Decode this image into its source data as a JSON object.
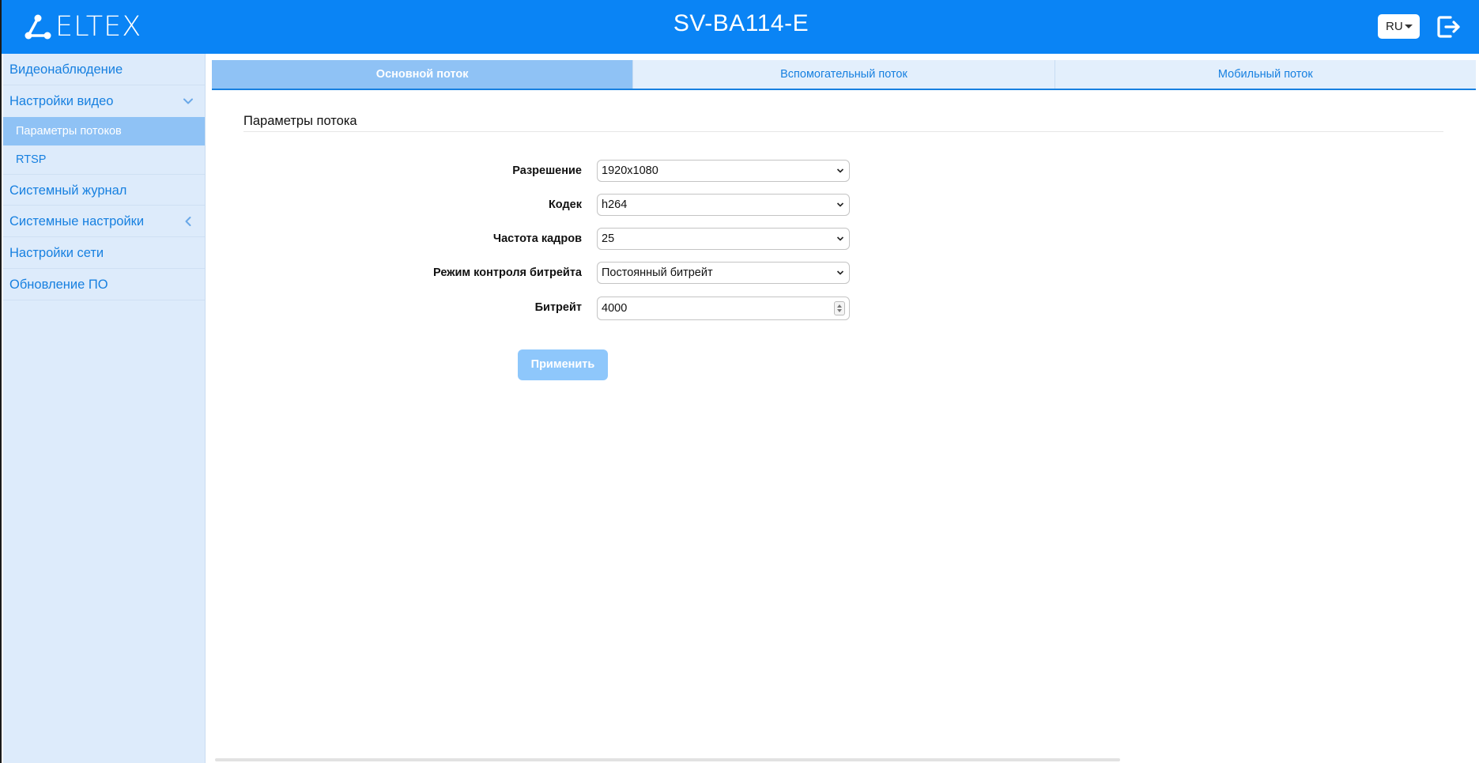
{
  "header": {
    "logo_text": "ELTEX",
    "device_title": "SV-BA114-E",
    "language": "RU"
  },
  "sidebar": {
    "items": [
      {
        "label": "Видеонаблюдение"
      },
      {
        "label": "Настройки видео",
        "expanded": true,
        "subitems": [
          {
            "label": "Параметры потоков",
            "active": true
          },
          {
            "label": "RTSP"
          }
        ]
      },
      {
        "label": "Системный журнал"
      },
      {
        "label": "Системные настройки",
        "expanded": false
      },
      {
        "label": "Настройки сети"
      },
      {
        "label": "Обновление ПО"
      }
    ]
  },
  "tabs": [
    {
      "label": "Основной поток",
      "active": true
    },
    {
      "label": "Вспомогательный поток"
    },
    {
      "label": "Мобильный поток"
    }
  ],
  "section": {
    "title": "Параметры потока"
  },
  "form": {
    "resolution": {
      "label": "Разрешение",
      "value": "1920x1080"
    },
    "codec": {
      "label": "Кодек",
      "value": "h264"
    },
    "framerate": {
      "label": "Частота кадров",
      "value": "25"
    },
    "bitrate_mode": {
      "label": "Режим контроля битрейта",
      "value": "Постоянный битрейт"
    },
    "bitrate": {
      "label": "Битрейт",
      "value": "4000"
    },
    "apply_label": "Применить"
  },
  "colors": {
    "header_bg": "#0a84f5",
    "sidebar_bg": "#ddebfb",
    "accent": "#1780e0",
    "active_bg": "#8fc2f5",
    "button_disabled": "#8ec7fb"
  }
}
